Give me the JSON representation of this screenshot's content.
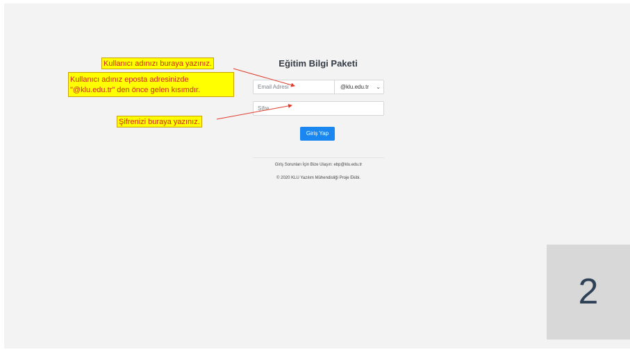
{
  "login": {
    "title": "Eğitim Bilgi Paketi",
    "email_placeholder": "Email Adresi",
    "domain_value": "@klu.edu.tr",
    "password_placeholder": "Şifre",
    "submit_label": "Giriş Yap",
    "help_text": "Giriş Sorunları İçin Bize Ulaşın: ebp@klu.edu.tr",
    "copyright_text": "© 2020 KLU Yazılım Mühendisliği Proje Ekibi."
  },
  "annotations": {
    "username": "Kullanıcı adınızı buraya yazınız.",
    "username_hint_line1": "Kullanıcı adınız eposta adresinizde",
    "username_hint_line2": "\"@klu.edu.tr\" den önce gelen kısımdır.",
    "password": "Şifrenizi buraya yazınız."
  },
  "slide_number": "2",
  "colors": {
    "primary_button": "#1a86f0",
    "callout_bg": "#ffff00",
    "callout_text": "#d02a10",
    "arrow": "#e03a2a"
  }
}
